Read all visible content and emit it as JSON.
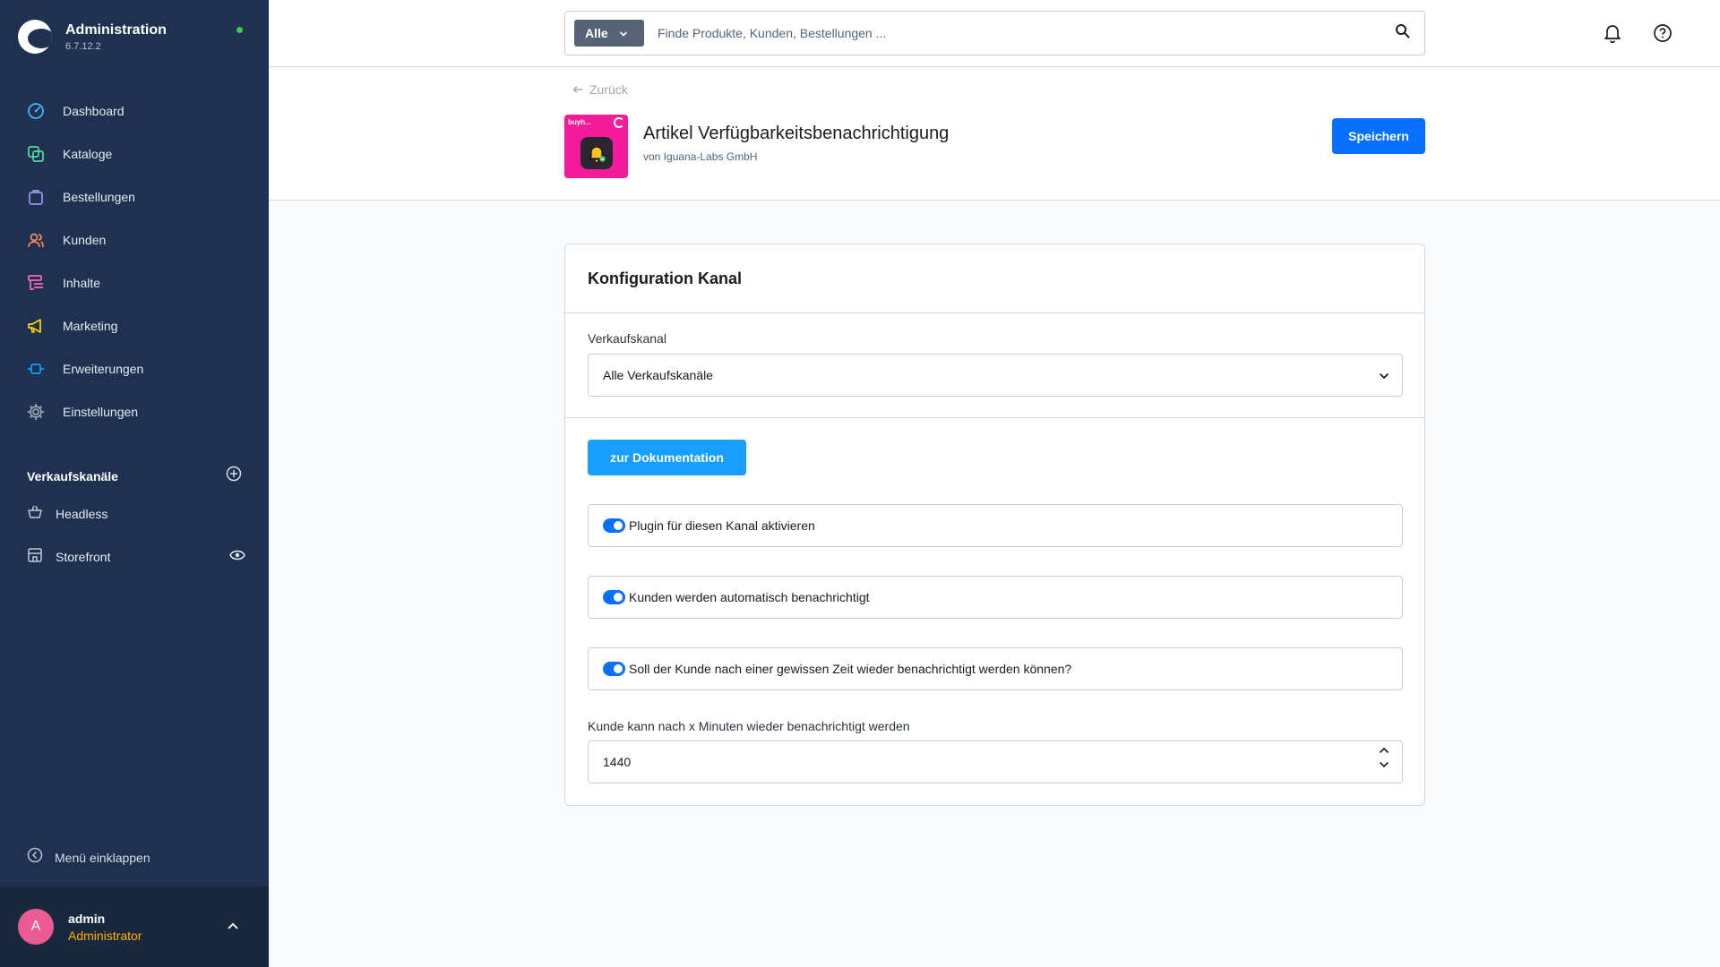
{
  "app": {
    "title": "Administration",
    "version": "6.7.12.2"
  },
  "sidebar": {
    "items": [
      {
        "label": "Dashboard",
        "icon": "gauge-icon",
        "color": "#4fb6ff"
      },
      {
        "label": "Kataloge",
        "icon": "catalog-icon",
        "color": "#57d9a3"
      },
      {
        "label": "Bestellungen",
        "icon": "shopping-bag-icon",
        "color": "#a092f0"
      },
      {
        "label": "Kunden",
        "icon": "users-icon",
        "color": "#f88962"
      },
      {
        "label": "Inhalte",
        "icon": "content-icon",
        "color": "#ff68b4"
      },
      {
        "label": "Marketing",
        "icon": "megaphone-icon",
        "color": "#ffd700"
      },
      {
        "label": "Erweiterungen",
        "icon": "plug-icon",
        "color": "#189eff"
      },
      {
        "label": "Einstellungen",
        "icon": "gear-icon",
        "color": "#9aa8b5"
      }
    ],
    "channels_title": "Verkaufskanäle",
    "channels": [
      {
        "label": "Headless",
        "icon": "basket-icon"
      },
      {
        "label": "Storefront",
        "icon": "storefront-icon"
      }
    ],
    "collapse_label": "Menü einklappen"
  },
  "user": {
    "initial": "A",
    "name": "admin",
    "role": "Administrator"
  },
  "search": {
    "type_label": "Alle",
    "placeholder": "Finde Produkte, Kunden, Bestellungen ..."
  },
  "plugin": {
    "back_label": "Zurück",
    "badge": "buyh...",
    "title": "Artikel Verfügbarkeitsbenachrichtigung",
    "vendor": "von Iguana-Labs GmbH",
    "save_label": "Speichern"
  },
  "config": {
    "card_title": "Konfiguration Kanal",
    "sales_channel_label": "Verkaufskanal",
    "sales_channel_value": "Alle Verkaufskanäle",
    "doc_button": "zur Dokumentation",
    "toggles": [
      {
        "label": "Plugin für diesen Kanal aktivieren",
        "enabled": true
      },
      {
        "label": "Kunden werden automatisch benachrichtigt",
        "enabled": true
      },
      {
        "label": "Soll der Kunde nach einer gewissen Zeit wieder benachrichtigt werden können?",
        "enabled": true
      }
    ],
    "minutes_label": "Kunde kann nach x Minuten wieder benachrichtigt werden",
    "minutes_value": "1440"
  },
  "colors": {
    "sidebar_bg": "#1f3150",
    "primary": "#0870ff",
    "doc_button": "#189eff",
    "status_online": "#37d046",
    "user_role": "#ffb200",
    "avatar": "#ee5a93",
    "plugin_icon_bg": "#f21c9b"
  }
}
